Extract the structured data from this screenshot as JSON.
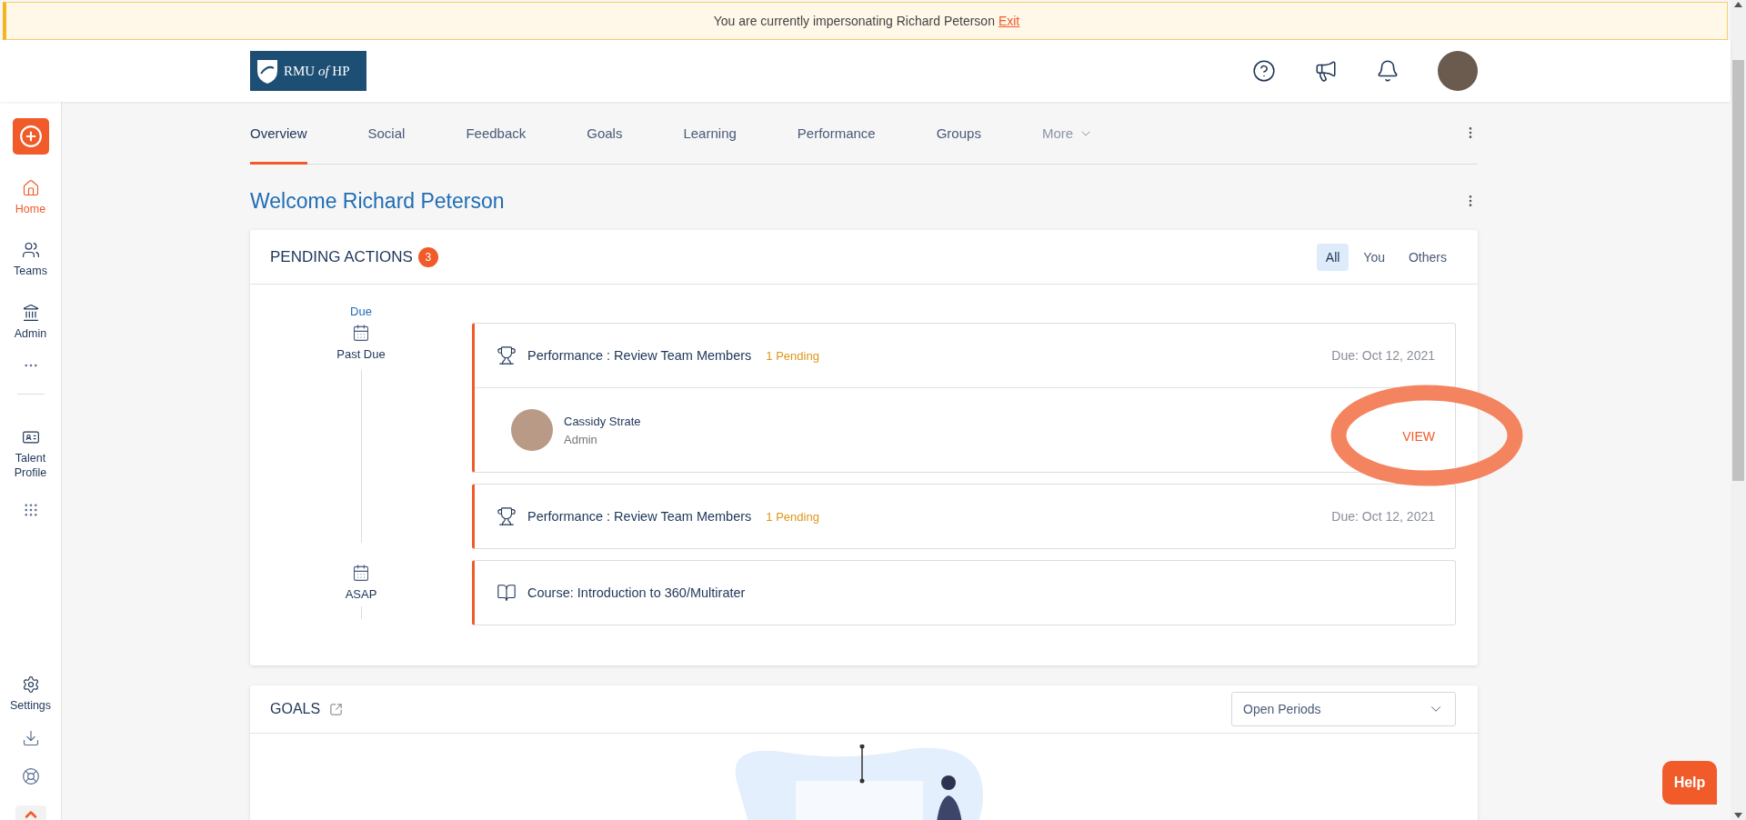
{
  "banner": {
    "text": "You are currently impersonating Richard Peterson",
    "link": "Exit"
  },
  "header": {
    "logo": "RMU *of* HP"
  },
  "sidebar": {
    "top_items": [
      {
        "label": "Home",
        "selected": true
      },
      {
        "label": "Teams",
        "selected": false
      },
      {
        "label": "Admin",
        "selected": false
      }
    ],
    "profile_item": {
      "label": "Talent Profile",
      "selected": false
    },
    "bottom_item": {
      "label": "Settings",
      "selected": false
    }
  },
  "tabs": [
    {
      "label": "Overview",
      "selected": true,
      "kind": "tab"
    },
    {
      "label": "Social",
      "selected": false,
      "kind": "tab"
    },
    {
      "label": "Feedback",
      "selected": false,
      "kind": "tab"
    },
    {
      "label": "Goals",
      "selected": false,
      "kind": "tab"
    },
    {
      "label": "Learning",
      "selected": false,
      "kind": "tab"
    },
    {
      "label": "Performance",
      "selected": false,
      "kind": "tab"
    },
    {
      "label": "Groups",
      "selected": false,
      "kind": "tab"
    },
    {
      "label": "More",
      "selected": false,
      "kind": "dropdown"
    }
  ],
  "welcome": "Welcome Richard Peterson",
  "pending_actions": {
    "title": "PENDING ACTIONS",
    "count": "3",
    "filters": [
      {
        "label": "All",
        "selected": true
      },
      {
        "label": "You",
        "selected": false
      },
      {
        "label": "Others",
        "selected": false
      }
    ],
    "timeline": [
      {
        "caption": "Due",
        "label": "Past Due"
      },
      {
        "label": "ASAP"
      }
    ],
    "actions": [
      {
        "kind": "performance",
        "title": "Performance : Review Team Members",
        "pending": "1 Pending",
        "due": "Due: Oct 12, 2021",
        "expanded": true,
        "people": [
          {
            "name": "Cassidy Strate",
            "role": "Admin",
            "action": "VIEW"
          }
        ]
      },
      {
        "kind": "performance",
        "title": "Performance : Review Team Members",
        "pending": "1 Pending",
        "due": "Due: Oct 12, 2021",
        "expanded": false
      },
      {
        "kind": "course",
        "title": "Course: Introduction to 360/Multirater",
        "expanded": false
      }
    ]
  },
  "goals": {
    "title": "GOALS",
    "period": "Open Periods"
  },
  "help": "Help"
}
